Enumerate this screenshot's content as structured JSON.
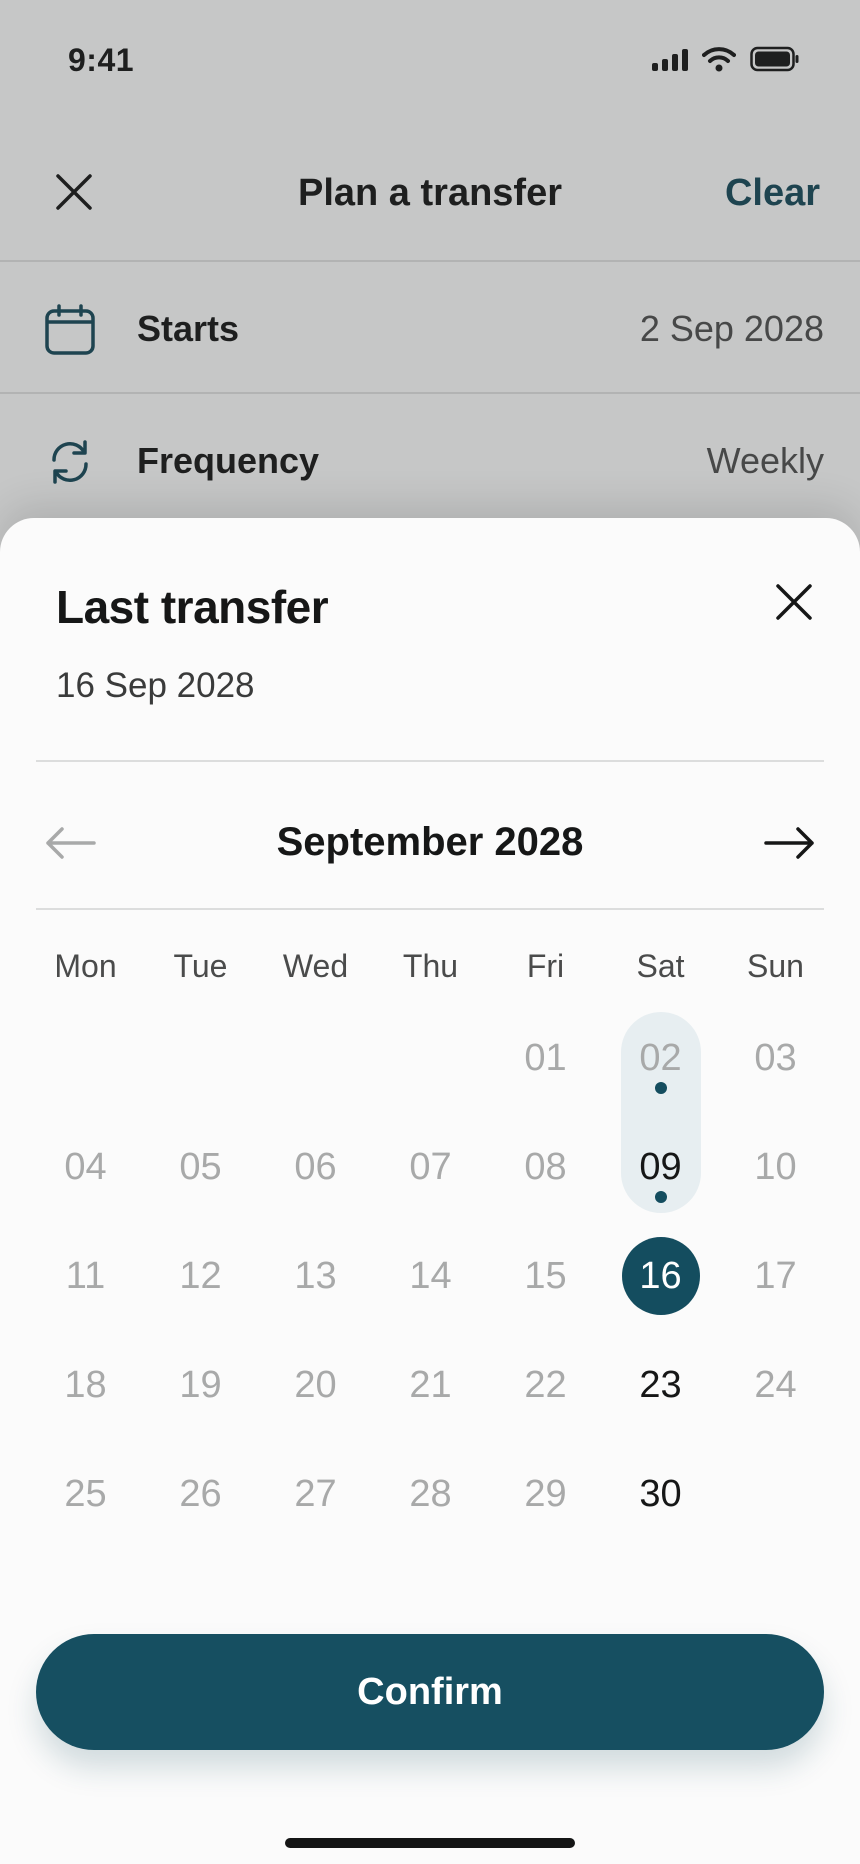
{
  "status_bar": {
    "time": "9:41"
  },
  "nav": {
    "title": "Plan a transfer",
    "clear_label": "Clear"
  },
  "rows": [
    {
      "label": "Starts",
      "value": "2 Sep 2028",
      "icon": "calendar-icon"
    },
    {
      "label": "Frequency",
      "value": "Weekly",
      "icon": "repeat-icon"
    }
  ],
  "sheet": {
    "title": "Last transfer",
    "selected_date": "16 Sep 2028",
    "month": "September 2028",
    "weekdays": [
      "Mon",
      "Tue",
      "Wed",
      "Thu",
      "Fri",
      "Sat",
      "Sun"
    ],
    "days": [
      [
        "",
        "",
        "",
        "",
        "01",
        "02",
        "03"
      ],
      [
        "04",
        "05",
        "06",
        "07",
        "08",
        "09",
        "10"
      ],
      [
        "11",
        "12",
        "13",
        "14",
        "15",
        "16",
        "17"
      ],
      [
        "18",
        "19",
        "20",
        "21",
        "22",
        "23",
        "24"
      ],
      [
        "25",
        "26",
        "27",
        "28",
        "29",
        "30",
        ""
      ]
    ],
    "scheduled_days": [
      "02",
      "09"
    ],
    "selected_day": "16",
    "enabled_days": [
      "09",
      "16",
      "23",
      "30"
    ],
    "confirm_label": "Confirm"
  },
  "colors": {
    "accent": "#144d5f",
    "highlight": "#e7eef1"
  }
}
